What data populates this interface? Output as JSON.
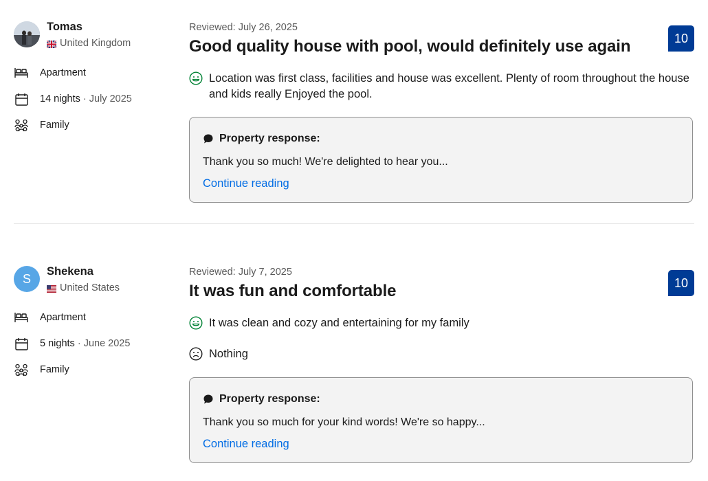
{
  "reviews": [
    {
      "reviewer": {
        "name": "Tomas",
        "country": "United Kingdom",
        "avatar": "photo"
      },
      "stay": {
        "room": "Apartment",
        "nights": "14 nights",
        "date": "July 2025",
        "traveler_type": "Family"
      },
      "reviewed_label": "Reviewed: July 26, 2025",
      "title": "Good quality house with pool, would definitely use again",
      "score": "10",
      "positive": "Location was first class, facilities and house was excellent. Plenty of room throughout the house and kids really Enjoyed the pool.",
      "negative": null,
      "response": {
        "heading": "Property response:",
        "text": "Thank you so much! We're delighted to hear you...",
        "link": "Continue reading"
      }
    },
    {
      "reviewer": {
        "name": "Shekena",
        "country": "United States",
        "avatar_letter": "S"
      },
      "stay": {
        "room": "Apartment",
        "nights": "5 nights",
        "date": "June 2025",
        "traveler_type": "Family"
      },
      "reviewed_label": "Reviewed: July 7, 2025",
      "title": "It was fun and comfortable",
      "score": "10",
      "positive": "It was clean and cozy and entertaining for my family",
      "negative": "Nothing",
      "response": {
        "heading": "Property response:",
        "text": "Thank you so much for your kind words! We're so happy...",
        "link": "Continue reading"
      }
    }
  ],
  "separator": " · ",
  "colors": {
    "score_bg": "#003b95",
    "link": "#006ce4",
    "positive_icon": "#008234",
    "avatar_letter_bg": "#57a6e6"
  }
}
